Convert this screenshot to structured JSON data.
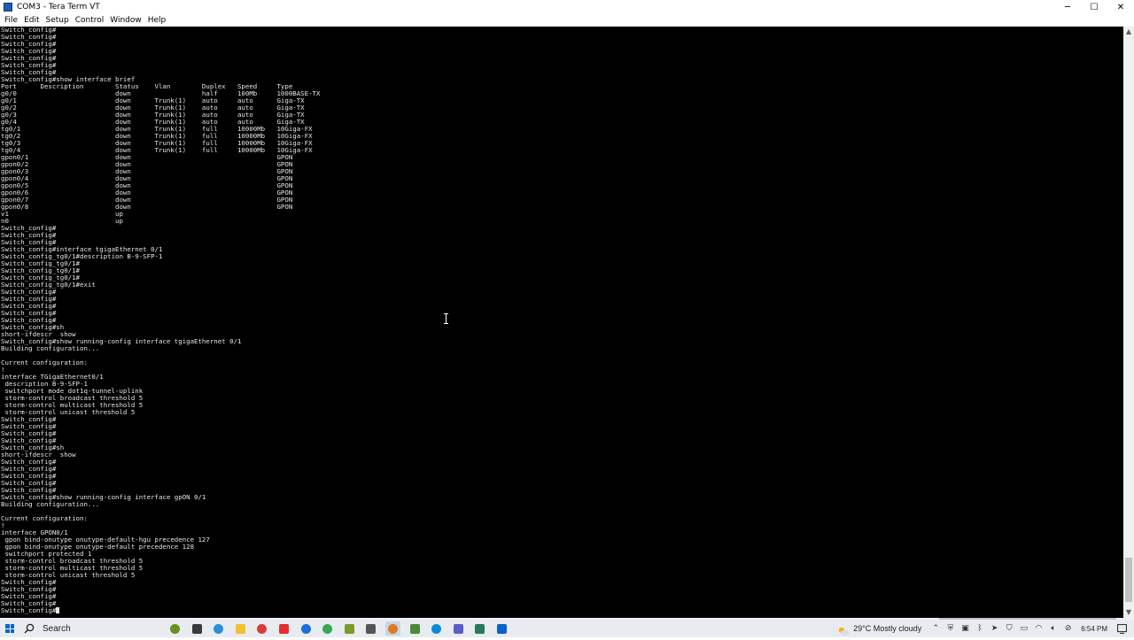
{
  "window": {
    "title": "COM3 - Tera Term VT",
    "controls": {
      "minimize": "─",
      "maximize": "☐",
      "close": "✕"
    }
  },
  "menu": {
    "items": [
      "File",
      "Edit",
      "Setup",
      "Control",
      "Window",
      "Help"
    ]
  },
  "terminal": {
    "lines": [
      "Switch_config#",
      "Switch_config#",
      "Switch_config#",
      "Switch_config#",
      "Switch_config#",
      "Switch_config#",
      "Switch_config#",
      "Switch_config#show interface brief",
      "Port      Description        Status    Vlan        Duplex   Speed     Type",
      "g0/0                         down                  half     100Mb     1000BASE-TX",
      "g0/1                         down      Trunk(1)    auto     auto      Giga-TX",
      "g0/2                         down      Trunk(1)    auto     auto      Giga-TX",
      "g0/3                         down      Trunk(1)    auto     auto      Giga-TX",
      "g0/4                         down      Trunk(1)    auto     auto      Giga-TX",
      "tg0/1                        down      Trunk(1)    full     10000Mb   10Giga-FX",
      "tg0/2                        down      Trunk(1)    full     10000Mb   10Giga-FX",
      "tg0/3                        down      Trunk(1)    full     10000Mb   10Giga-FX",
      "tg0/4                        down      Trunk(1)    full     10000Mb   10Giga-FX",
      "gpon0/1                      down                                     GPON",
      "gpon0/2                      down                                     GPON",
      "gpon0/3                      down                                     GPON",
      "gpon0/4                      down                                     GPON",
      "gpon0/5                      down                                     GPON",
      "gpon0/6                      down                                     GPON",
      "gpon0/7                      down                                     GPON",
      "gpon0/8                      down                                     GPON",
      "v1                           up",
      "n0                           up",
      "Switch_config#",
      "Switch_config#",
      "Switch_config#",
      "Switch_config#interface tgigaEthernet 0/1",
      "Switch_config_tg0/1#description B-9-SFP-1",
      "Switch_config_tg0/1#",
      "Switch_config_tg0/1#",
      "Switch_config_tg0/1#",
      "Switch_config_tg0/1#exit",
      "Switch_config#",
      "Switch_config#",
      "Switch_config#",
      "Switch_config#",
      "Switch_config#",
      "Switch_config#sh",
      "short-ifdescr  show",
      "Switch_config#show running-config interface tgigaEthernet 0/1",
      "Building configuration...",
      "",
      "Current configuration:",
      "!",
      "interface TGigaEthernet0/1",
      " description B-9-SFP-1",
      " switchport mode dot1q-tunnel-uplink",
      " storm-control broadcast threshold 5",
      " storm-control multicast threshold 5",
      " storm-control unicast threshold 5",
      "Switch_config#",
      "Switch_config#",
      "Switch_config#",
      "Switch_config#",
      "Switch_config#sh",
      "short-ifdescr  show",
      "Switch_config#",
      "Switch_config#",
      "Switch_config#",
      "Switch_config#",
      "Switch_config#",
      "Switch_config#show running-config interface gpON 0/1",
      "Building configuration...",
      "",
      "Current configuration:",
      "!",
      "interface GPON0/1",
      " gpon bind-onutype onutype-default-hgu precedence 127",
      " gpon bind-onutype onutype-default precedence 128",
      " switchport protected 1",
      " storm-control broadcast threshold 5",
      " storm-control multicast threshold 5",
      " storm-control unicast threshold 5",
      "Switch_config#",
      "Switch_config#",
      "Switch_config#",
      "Switch_config#",
      "Switch_config#"
    ]
  },
  "taskbar": {
    "search_label": "Search",
    "apps": [
      {
        "name": "bike-app-icon",
        "color": "#6b8e23",
        "round": true,
        "active": false
      },
      {
        "name": "task-view-icon",
        "color": "#3a3a3a",
        "round": false,
        "active": false
      },
      {
        "name": "copilot-icon",
        "color": "#2b8fd9",
        "round": true,
        "active": false
      },
      {
        "name": "file-explorer-icon",
        "color": "#f2c12e",
        "round": false,
        "active": false
      },
      {
        "name": "shield-app-icon",
        "color": "#d43f3a",
        "round": true,
        "active": false
      },
      {
        "name": "red-app-icon",
        "color": "#e03030",
        "round": false,
        "active": false
      },
      {
        "name": "blue-globe-icon",
        "color": "#1e6fd9",
        "round": true,
        "active": false
      },
      {
        "name": "chrome-icon",
        "color": "#34a853",
        "round": true,
        "active": false
      },
      {
        "name": "notes-app-icon",
        "color": "#7a9a2a",
        "round": false,
        "active": false
      },
      {
        "name": "keyboard-app-icon",
        "color": "#555555",
        "round": false,
        "active": false
      },
      {
        "name": "tera-term-icon",
        "color": "#e07a1f",
        "round": true,
        "active": true
      },
      {
        "name": "notepad-icon",
        "color": "#4a8a3a",
        "round": false,
        "active": false
      },
      {
        "name": "edge-icon",
        "color": "#0c8ad8",
        "round": true,
        "active": false
      },
      {
        "name": "teams-icon",
        "color": "#5b5fc7",
        "round": false,
        "active": false
      },
      {
        "name": "paint-icon",
        "color": "#2a7a5a",
        "round": false,
        "active": false
      },
      {
        "name": "outlook-icon",
        "color": "#0a64c8",
        "round": false,
        "active": false
      }
    ]
  },
  "tray": {
    "weather": "29°C  Mostly cloudy",
    "clock": "6:54 PM",
    "icons": [
      {
        "name": "show-hidden-icons-icon",
        "glyph": "⌃"
      },
      {
        "name": "security-tray-icon",
        "glyph": "⛨"
      },
      {
        "name": "network-tray-icon",
        "glyph": "▣"
      },
      {
        "name": "bluetooth-tray-icon",
        "glyph": "ᛒ"
      },
      {
        "name": "location-tray-icon",
        "glyph": "➤"
      },
      {
        "name": "shield-tray-icon",
        "glyph": "⛉"
      },
      {
        "name": "battery-tray-icon",
        "glyph": "▭"
      },
      {
        "name": "wifi-tray-icon",
        "glyph": "◠"
      },
      {
        "name": "volume-tray-icon",
        "glyph": "🔈︎"
      },
      {
        "name": "muted-tray-icon",
        "glyph": "⊘"
      }
    ]
  }
}
